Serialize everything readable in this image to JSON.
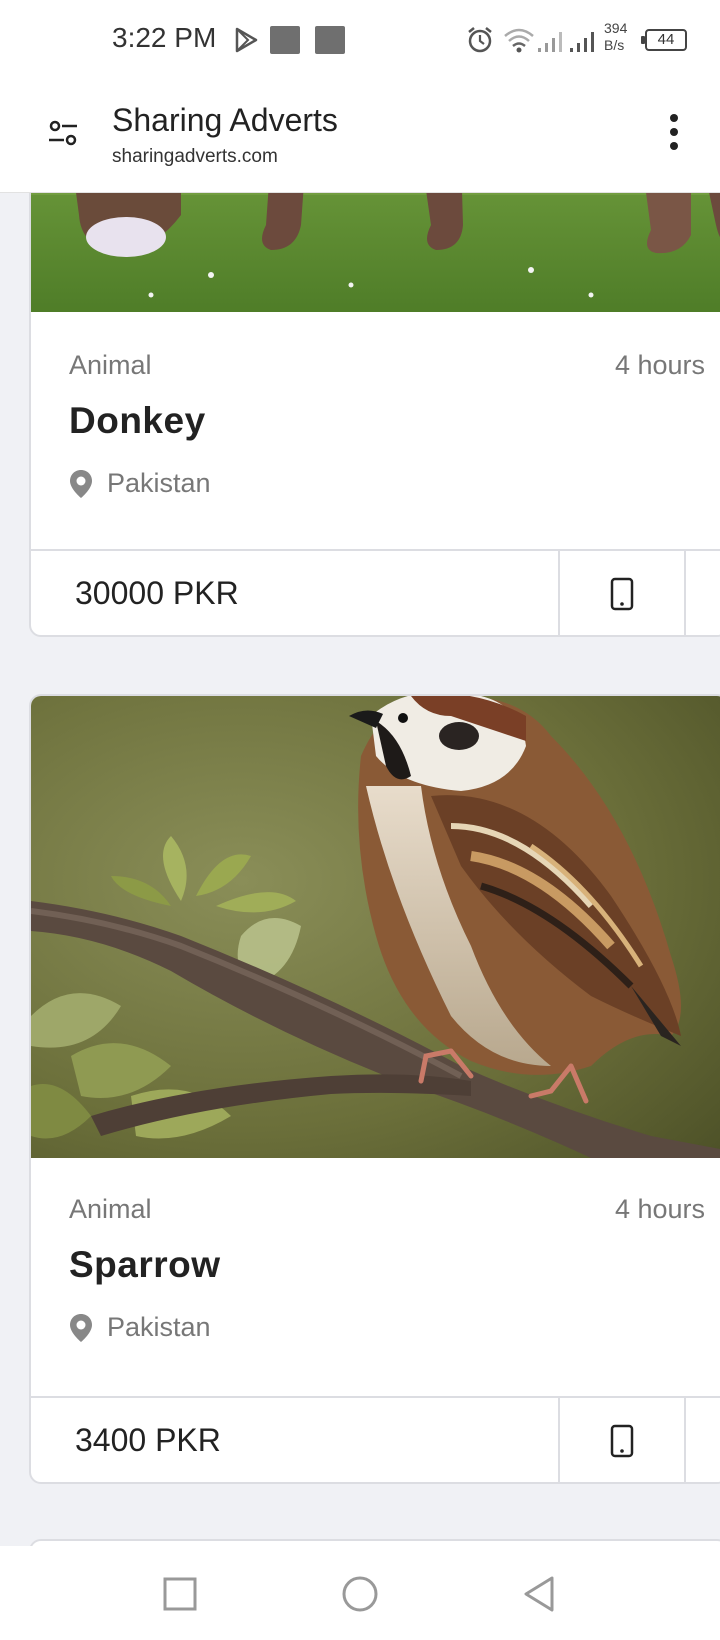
{
  "status_bar": {
    "time": "3:22 PM",
    "net_speed_value": "394",
    "net_speed_unit": "B/s",
    "battery": "44",
    "icons": [
      "play-store-icon",
      "notification-icon",
      "notification-icon",
      "alarm-icon",
      "wifi-icon",
      "signal-icon",
      "signal-icon",
      "battery-icon"
    ]
  },
  "header": {
    "title": "Sharing Adverts",
    "url": "sharingadverts.com",
    "icons": [
      "filter-icon",
      "more-options-icon"
    ]
  },
  "listings": [
    {
      "category": "Animal",
      "time_ago": "4 hours",
      "title": "Donkey",
      "location": "Pakistan",
      "price": "30000 PKR",
      "image": "donkey-photo"
    },
    {
      "category": "Animal",
      "time_ago": "4 hours",
      "title": "Sparrow",
      "location": "Pakistan",
      "price": "3400 PKR",
      "image": "sparrow-photo"
    }
  ],
  "nav_bar": {
    "icons": [
      "recent-apps-icon",
      "home-icon",
      "back-icon"
    ]
  },
  "colors": {
    "background": "#f0f1f5",
    "card_border": "#dcdde2",
    "muted_text": "#777777",
    "title_text": "#222222"
  }
}
